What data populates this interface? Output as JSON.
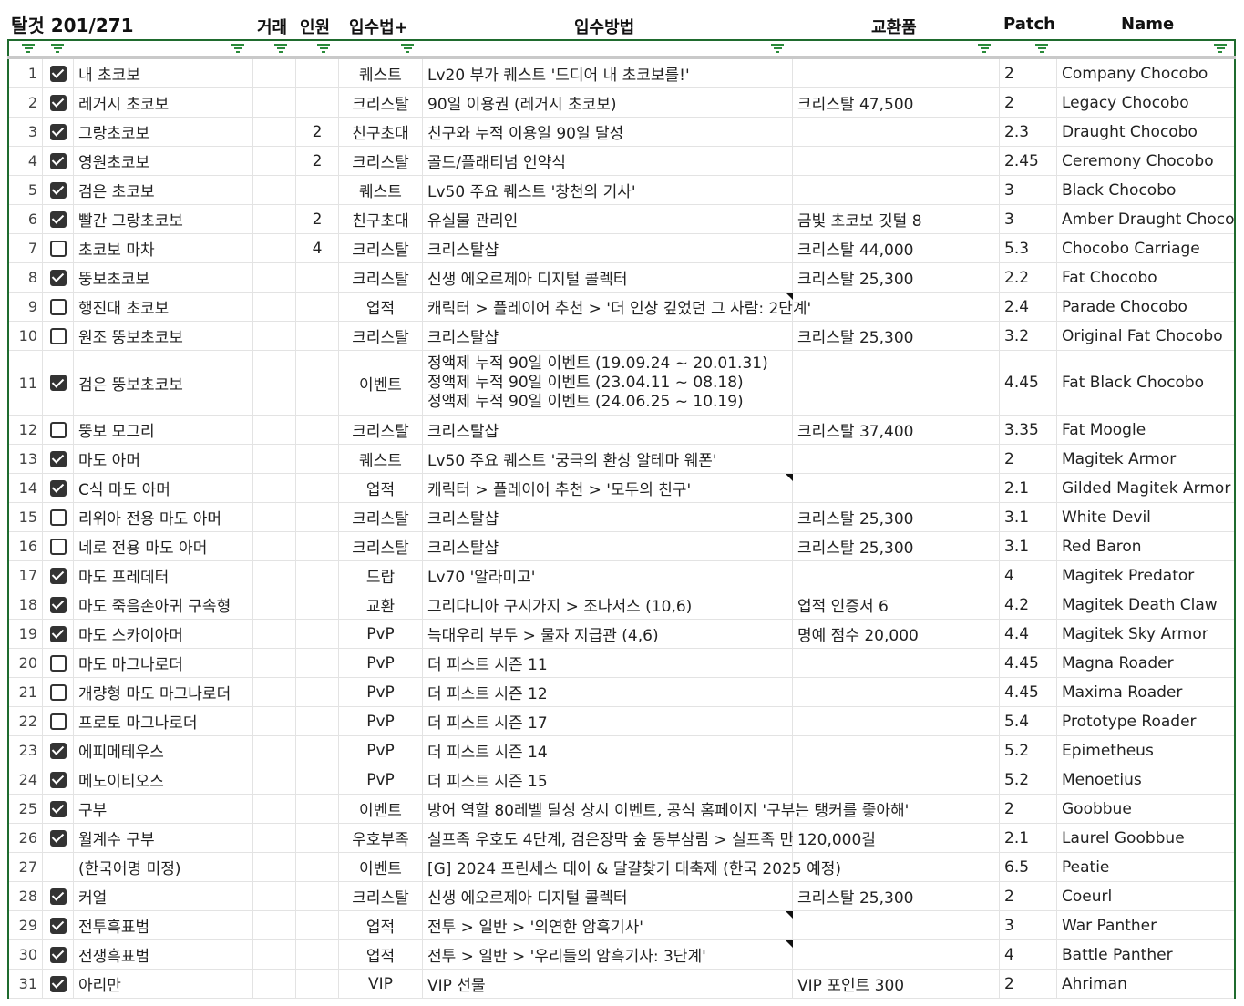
{
  "header": {
    "title": "탈것 201/271",
    "cols": {
      "trade": "거래",
      "people": "인원",
      "method": "입수법+",
      "detail": "입수방법",
      "exchange": "교환품",
      "patch": "Patch",
      "name": "Name"
    }
  },
  "colors": {
    "accent": "#1f6b2e",
    "filter_icon": "#2a8a3a",
    "note_marker": "#111111"
  },
  "rows": [
    {
      "n": "1",
      "checked": true,
      "kor": "내 초코보",
      "trade": "",
      "people": "",
      "method": "퀘스트",
      "detail": "Lv20 부가 퀘스트 '드디어 내 초코보를!'",
      "exch": "",
      "patch": "2",
      "name": "Company Chocobo"
    },
    {
      "n": "2",
      "checked": true,
      "kor": "레거시 초코보",
      "trade": "",
      "people": "",
      "method": "크리스탈",
      "detail": "90일 이용권 (레거시 초코보)",
      "exch": "크리스탈 47,500",
      "patch": "2",
      "name": "Legacy Chocobo"
    },
    {
      "n": "3",
      "checked": true,
      "kor": "그랑초코보",
      "trade": "",
      "people": "2",
      "method": "친구초대",
      "detail": "친구와 누적 이용일 90일 달성",
      "exch": "",
      "patch": "2.3",
      "name": "Draught Chocobo"
    },
    {
      "n": "4",
      "checked": true,
      "kor": "영원초코보",
      "trade": "",
      "people": "2",
      "method": "크리스탈",
      "detail": "골드/플래티넘 언약식",
      "exch": "",
      "patch": "2.45",
      "name": "Ceremony Chocobo"
    },
    {
      "n": "5",
      "checked": true,
      "kor": "검은 초코보",
      "trade": "",
      "people": "",
      "method": "퀘스트",
      "detail": "Lv50 주요 퀘스트 '창천의 기사'",
      "exch": "",
      "patch": "3",
      "name": "Black Chocobo"
    },
    {
      "n": "6",
      "checked": true,
      "kor": "빨간 그랑초코보",
      "trade": "",
      "people": "2",
      "method": "친구초대",
      "detail": "유실물 관리인",
      "exch": "금빛 초코보 깃털 8",
      "patch": "3",
      "name": "Amber Draught Chocobo"
    },
    {
      "n": "7",
      "checked": false,
      "kor": "초코보 마차",
      "trade": "",
      "people": "4",
      "method": "크리스탈",
      "detail": "크리스탈샵",
      "exch": "크리스탈 44,000",
      "patch": "5.3",
      "name": "Chocobo Carriage"
    },
    {
      "n": "8",
      "checked": true,
      "kor": "뚱보초코보",
      "trade": "",
      "people": "",
      "method": "크리스탈",
      "detail": "신생 에오르제아 디지털 콜렉터",
      "exch": "크리스탈 25,300",
      "patch": "2.2",
      "name": "Fat Chocobo"
    },
    {
      "n": "9",
      "checked": false,
      "kor": "행진대 초코보",
      "trade": "",
      "people": "",
      "method": "업적",
      "detail": "캐릭터 > 플레이어 추천 > '더 인상 깊었던 그 사람: 2단계'",
      "exch": "",
      "patch": "2.4",
      "name": "Parade Chocobo",
      "note": true
    },
    {
      "n": "10",
      "checked": false,
      "kor": "원조 뚱보초코보",
      "trade": "",
      "people": "",
      "method": "크리스탈",
      "detail": "크리스탈샵",
      "exch": "크리스탈 25,300",
      "patch": "3.2",
      "name": "Original Fat Chocobo"
    },
    {
      "n": "11",
      "checked": true,
      "kor": "검은 뚱보초코보",
      "trade": "",
      "people": "",
      "method": "이벤트",
      "detail_lines": [
        "정액제 누적 90일 이벤트 (19.09.24 ~ 20.01.31)",
        "정액제 누적 90일 이벤트 (23.04.11 ~ 08.18)",
        "정액제 누적 90일 이벤트 (24.06.25 ~ 10.19)"
      ],
      "exch": "",
      "patch": "4.45",
      "name": "Fat Black Chocobo"
    },
    {
      "n": "12",
      "checked": false,
      "kor": "뚱보 모그리",
      "trade": "",
      "people": "",
      "method": "크리스탈",
      "detail": "크리스탈샵",
      "exch": "크리스탈 37,400",
      "patch": "3.35",
      "name": "Fat Moogle"
    },
    {
      "n": "13",
      "checked": true,
      "kor": "마도 아머",
      "trade": "",
      "people": "",
      "method": "퀘스트",
      "detail": "Lv50 주요 퀘스트 '궁극의 환상 알테마 웨폰'",
      "exch": "",
      "patch": "2",
      "name": "Magitek Armor"
    },
    {
      "n": "14",
      "checked": true,
      "kor": "C식 마도 아머",
      "trade": "",
      "people": "",
      "method": "업적",
      "detail": "캐릭터 > 플레이어 추천 > '모두의 친구'",
      "exch": "",
      "patch": "2.1",
      "name": "Gilded Magitek Armor",
      "note": true
    },
    {
      "n": "15",
      "checked": false,
      "kor": "리위아 전용 마도 아머",
      "trade": "",
      "people": "",
      "method": "크리스탈",
      "detail": "크리스탈샵",
      "exch": "크리스탈 25,300",
      "patch": "3.1",
      "name": "White Devil"
    },
    {
      "n": "16",
      "checked": false,
      "kor": "네로 전용 마도 아머",
      "trade": "",
      "people": "",
      "method": "크리스탈",
      "detail": "크리스탈샵",
      "exch": "크리스탈 25,300",
      "patch": "3.1",
      "name": "Red Baron"
    },
    {
      "n": "17",
      "checked": true,
      "kor": "마도 프레데터",
      "trade": "",
      "people": "",
      "method": "드랍",
      "detail": "Lv70 '알라미고'",
      "exch": "",
      "patch": "4",
      "name": "Magitek Predator"
    },
    {
      "n": "18",
      "checked": true,
      "kor": "마도 죽음손아귀 구속형",
      "trade": "",
      "people": "",
      "method": "교환",
      "detail": "그리다니아 구시가지 > 조나서스 (10,6)",
      "exch": "업적 인증서 6",
      "patch": "4.2",
      "name": "Magitek Death Claw"
    },
    {
      "n": "19",
      "checked": true,
      "kor": "마도 스카이아머",
      "trade": "",
      "people": "",
      "method": "PvP",
      "detail": "늑대우리 부두 > 물자 지급관 (4,6)",
      "exch": "명예 점수 20,000",
      "patch": "4.4",
      "name": "Magitek Sky Armor"
    },
    {
      "n": "20",
      "checked": false,
      "kor": "마도 마그나로더",
      "trade": "",
      "people": "",
      "method": "PvP",
      "detail": "더 피스트 시즌 11",
      "exch": "",
      "patch": "4.45",
      "name": "Magna Roader"
    },
    {
      "n": "21",
      "checked": false,
      "kor": "개량형 마도 마그나로더",
      "trade": "",
      "people": "",
      "method": "PvP",
      "detail": "더 피스트 시즌 12",
      "exch": "",
      "patch": "4.45",
      "name": "Maxima Roader"
    },
    {
      "n": "22",
      "checked": false,
      "kor": "프로토 마그나로더",
      "trade": "",
      "people": "",
      "method": "PvP",
      "detail": "더 피스트 시즌 17",
      "exch": "",
      "patch": "5.4",
      "name": "Prototype Roader"
    },
    {
      "n": "23",
      "checked": true,
      "kor": "에피메테우스",
      "trade": "",
      "people": "",
      "method": "PvP",
      "detail": "더 피스트 시즌 14",
      "exch": "",
      "patch": "5.2",
      "name": "Epimetheus"
    },
    {
      "n": "24",
      "checked": true,
      "kor": "메노이티오스",
      "trade": "",
      "people": "",
      "method": "PvP",
      "detail": "더 피스트 시즌 15",
      "exch": "",
      "patch": "5.2",
      "name": "Menoetius"
    },
    {
      "n": "25",
      "checked": true,
      "kor": "구부",
      "trade": "",
      "people": "",
      "method": "이벤트",
      "detail": "방어 역할 80레벨 달성 상시 이벤트, 공식 홈페이지 '구부는 탱커를 좋아해'",
      "exch": "",
      "patch": "2",
      "name": "Goobbue"
    },
    {
      "n": "26",
      "checked": true,
      "kor": "월계수 구부",
      "trade": "",
      "people": "",
      "method": "우호부족",
      "detail": "실프족 우호도 4단계, 검은장막 숲 동부삼림 > 실프족 만",
      "exch": "120,000길",
      "patch": "2.1",
      "name": "Laurel Goobbue"
    },
    {
      "n": "27",
      "checked": null,
      "kor": "(한국어명 미정)",
      "trade": "",
      "people": "",
      "method": "이벤트",
      "detail": "[G] 2024 프린세스 데이 & 달걀찾기 대축제 (한국 2025 예정)",
      "exch": "",
      "patch": "6.5",
      "name": "Peatie"
    },
    {
      "n": "28",
      "checked": true,
      "kor": "커얼",
      "trade": "",
      "people": "",
      "method": "크리스탈",
      "detail": "신생 에오르제아 디지털 콜렉터",
      "exch": "크리스탈 25,300",
      "patch": "2",
      "name": "Coeurl"
    },
    {
      "n": "29",
      "checked": true,
      "kor": "전투흑표범",
      "trade": "",
      "people": "",
      "method": "업적",
      "detail": "전투 > 일반 > '의연한 암흑기사'",
      "exch": "",
      "patch": "3",
      "name": "War Panther",
      "note": true
    },
    {
      "n": "30",
      "checked": true,
      "kor": "전쟁흑표범",
      "trade": "",
      "people": "",
      "method": "업적",
      "detail": "전투 > 일반 > '우리들의 암흑기사: 3단계'",
      "exch": "",
      "patch": "4",
      "name": "Battle Panther",
      "note": true
    },
    {
      "n": "31",
      "checked": true,
      "kor": "아리만",
      "trade": "",
      "people": "",
      "method": "VIP",
      "detail": "VIP 선물",
      "exch": "VIP 포인트 300",
      "patch": "2",
      "name": "Ahriman"
    }
  ]
}
